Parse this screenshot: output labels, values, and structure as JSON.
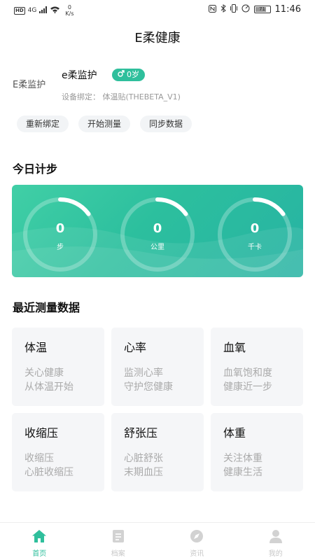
{
  "status_bar": {
    "hd_badge": "HD",
    "network_type": "4G",
    "net_speed_value": "0",
    "net_speed_unit": "K/s",
    "battery": "71",
    "time": "11:46"
  },
  "header": {
    "title": "E柔健康"
  },
  "device": {
    "logo_text": "E柔监护",
    "name": "e柔监护",
    "badge_icon": "male-icon",
    "badge_text": "0岁",
    "binding": "设备绑定：   体温贴(THEBETA_V1)"
  },
  "actions": [
    {
      "label": "重新绑定"
    },
    {
      "label": "开始测量"
    },
    {
      "label": "同步数据"
    }
  ],
  "steps_section": {
    "title": "今日计步",
    "rings": [
      {
        "value": "0",
        "unit": "步",
        "progress": 0.15
      },
      {
        "value": "0",
        "unit": "公里",
        "progress": 0.15
      },
      {
        "value": "0",
        "unit": "千卡",
        "progress": 0.15
      }
    ]
  },
  "recent_section": {
    "title": "最近测量数据",
    "tiles": [
      {
        "title": "体温",
        "line1": "关心健康",
        "line2": "从体温开始"
      },
      {
        "title": "心率",
        "line1": "监测心率",
        "line2": "守护您健康"
      },
      {
        "title": "血氧",
        "line1": "血氧饱和度",
        "line2": "健康近一步"
      },
      {
        "title": "收缩压",
        "line1": "收缩压",
        "line2": "心脏收缩压"
      },
      {
        "title": "舒张压",
        "line1": "心脏舒张",
        "line2": "末期血压"
      },
      {
        "title": "体重",
        "line1": "关注体重",
        "line2": "健康生活"
      }
    ]
  },
  "bottom_nav": {
    "items": [
      {
        "label": "首页",
        "icon": "home-icon",
        "active": true
      },
      {
        "label": "档案",
        "icon": "document-icon",
        "active": false
      },
      {
        "label": "资讯",
        "icon": "compass-icon",
        "active": false
      },
      {
        "label": "我的",
        "icon": "user-icon",
        "active": false
      }
    ]
  },
  "colors": {
    "accent": "#2fbf9c",
    "tile_bg": "#f5f6f8",
    "inactive": "#c8c8c8"
  }
}
